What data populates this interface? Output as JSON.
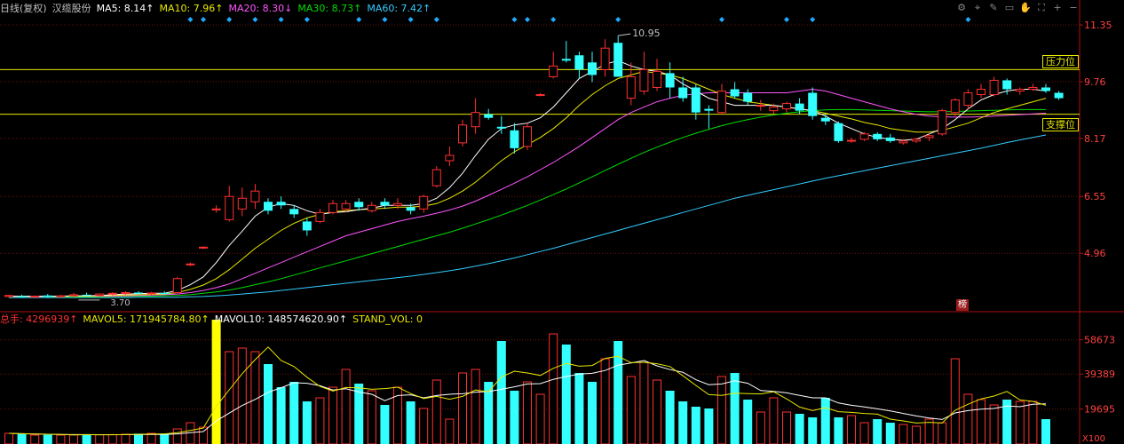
{
  "header": {
    "period": "日线(复权)",
    "stock_name": "汉缆股份",
    "ma": [
      {
        "label": "MA5: 8.14",
        "arrow": "↑",
        "color": "#ffffff"
      },
      {
        "label": "MA10: 7.96",
        "arrow": "↑",
        "color": "#e8e800"
      },
      {
        "label": "MA20: 8.30",
        "arrow": "↓",
        "color": "#ff55ff"
      },
      {
        "label": "MA30: 8.73",
        "arrow": "↑",
        "color": "#00dd00"
      },
      {
        "label": "MA60: 7.42",
        "arrow": "↑",
        "color": "#33ccff"
      }
    ],
    "vol": [
      {
        "label": "总手: 4296939",
        "arrow": "↑",
        "color": "#ff3030"
      },
      {
        "label": "MAVOL5: 171945784.80",
        "arrow": "↑",
        "color": "#e8e800"
      },
      {
        "label": "MAVOL10: 148574620.90",
        "arrow": "↑",
        "color": "#ffffff"
      },
      {
        "label": "STAND_VOL: 0",
        "arrow": "",
        "color": "#e8e800"
      }
    ]
  },
  "toolbar": {
    "icons": [
      "gear-icon",
      "magnet-icon",
      "pen-icon",
      "toolbox-icon",
      "hand-icon",
      "fullscreen-icon",
      "zoom-in-icon",
      "zoom-out-icon"
    ],
    "glyphs": [
      "⚙",
      "⌖",
      "✎",
      "▭",
      "✋",
      "⛶",
      "+",
      "−"
    ]
  },
  "annotations": {
    "resistance": "压力位",
    "support": "支撑位",
    "high": "10.95",
    "low": "3.70",
    "rank_badge": "榜"
  },
  "colors": {
    "up": "#ff3030",
    "down": "#33ffff",
    "grid": "#6a1010",
    "axis": "#b01010",
    "level": "#e8e800",
    "volume_surge": "#ffff00"
  },
  "chart_data": [
    {
      "type": "candlestick",
      "ylim": [
        3.4,
        11.6
      ],
      "y_ticks": [
        11.35,
        9.76,
        8.17,
        6.55,
        4.96
      ],
      "horizontal_levels": [
        {
          "name": "压力位",
          "value": 10.1
        },
        {
          "name": "支撑位",
          "value": 8.85
        }
      ],
      "grid": true,
      "markers_count": 18,
      "candles": [
        {
          "o": 3.75,
          "h": 3.8,
          "l": 3.72,
          "c": 3.78
        },
        {
          "o": 3.76,
          "h": 3.8,
          "l": 3.72,
          "c": 3.74
        },
        {
          "o": 3.74,
          "h": 3.78,
          "l": 3.7,
          "c": 3.76
        },
        {
          "o": 3.78,
          "h": 3.82,
          "l": 3.72,
          "c": 3.74
        },
        {
          "o": 3.74,
          "h": 3.8,
          "l": 3.72,
          "c": 3.77
        },
        {
          "o": 3.77,
          "h": 3.85,
          "l": 3.74,
          "c": 3.8
        },
        {
          "o": 3.8,
          "h": 3.86,
          "l": 3.76,
          "c": 3.78
        },
        {
          "o": 3.78,
          "h": 3.84,
          "l": 3.75,
          "c": 3.82
        },
        {
          "o": 3.82,
          "h": 3.87,
          "l": 3.78,
          "c": 3.84
        },
        {
          "o": 3.84,
          "h": 3.9,
          "l": 3.8,
          "c": 3.86
        },
        {
          "o": 3.86,
          "h": 3.9,
          "l": 3.8,
          "c": 3.83
        },
        {
          "o": 3.83,
          "h": 3.88,
          "l": 3.78,
          "c": 3.85
        },
        {
          "o": 3.85,
          "h": 3.9,
          "l": 3.82,
          "c": 3.82
        },
        {
          "o": 3.86,
          "h": 4.3,
          "l": 3.84,
          "c": 4.25
        },
        {
          "o": 4.66,
          "h": 4.7,
          "l": 4.6,
          "c": 4.66
        },
        {
          "o": 5.13,
          "h": 5.16,
          "l": 5.08,
          "c": 5.13
        },
        {
          "o": 6.2,
          "h": 6.3,
          "l": 6.1,
          "c": 6.2
        },
        {
          "o": 5.9,
          "h": 6.85,
          "l": 5.85,
          "c": 6.55
        },
        {
          "o": 6.2,
          "h": 6.8,
          "l": 6.0,
          "c": 6.5
        },
        {
          "o": 6.4,
          "h": 6.9,
          "l": 6.2,
          "c": 6.7
        },
        {
          "o": 6.4,
          "h": 6.5,
          "l": 6.05,
          "c": 6.15
        },
        {
          "o": 6.4,
          "h": 6.55,
          "l": 6.2,
          "c": 6.3
        },
        {
          "o": 6.2,
          "h": 6.3,
          "l": 5.95,
          "c": 6.05
        },
        {
          "o": 5.85,
          "h": 5.95,
          "l": 5.45,
          "c": 5.6
        },
        {
          "o": 5.85,
          "h": 6.2,
          "l": 5.8,
          "c": 6.1
        },
        {
          "o": 6.1,
          "h": 6.45,
          "l": 6.05,
          "c": 6.35
        },
        {
          "o": 6.2,
          "h": 6.45,
          "l": 6.1,
          "c": 6.35
        },
        {
          "o": 6.4,
          "h": 6.5,
          "l": 6.15,
          "c": 6.25
        },
        {
          "o": 6.15,
          "h": 6.4,
          "l": 6.1,
          "c": 6.3
        },
        {
          "o": 6.4,
          "h": 6.5,
          "l": 6.2,
          "c": 6.3
        },
        {
          "o": 6.3,
          "h": 6.5,
          "l": 6.2,
          "c": 6.35
        },
        {
          "o": 6.25,
          "h": 6.35,
          "l": 6.05,
          "c": 6.15
        },
        {
          "o": 6.2,
          "h": 6.6,
          "l": 6.1,
          "c": 6.55
        },
        {
          "o": 6.85,
          "h": 7.4,
          "l": 6.8,
          "c": 7.3
        },
        {
          "o": 7.55,
          "h": 7.95,
          "l": 7.4,
          "c": 7.7
        },
        {
          "o": 8.05,
          "h": 8.7,
          "l": 7.95,
          "c": 8.55
        },
        {
          "o": 8.5,
          "h": 9.3,
          "l": 8.3,
          "c": 8.9
        },
        {
          "o": 8.85,
          "h": 9.0,
          "l": 8.7,
          "c": 8.75
        },
        {
          "o": 8.5,
          "h": 8.8,
          "l": 8.3,
          "c": 8.45
        },
        {
          "o": 8.4,
          "h": 8.6,
          "l": 7.75,
          "c": 7.9
        },
        {
          "o": 7.95,
          "h": 8.6,
          "l": 7.85,
          "c": 8.5
        },
        {
          "o": 9.4,
          "h": 9.45,
          "l": 9.35,
          "c": 9.4
        },
        {
          "o": 9.9,
          "h": 10.6,
          "l": 9.85,
          "c": 10.2
        },
        {
          "o": 10.4,
          "h": 10.9,
          "l": 10.3,
          "c": 10.35
        },
        {
          "o": 10.5,
          "h": 10.6,
          "l": 9.85,
          "c": 10.1
        },
        {
          "o": 10.3,
          "h": 10.6,
          "l": 9.75,
          "c": 9.95
        },
        {
          "o": 10.1,
          "h": 10.95,
          "l": 9.9,
          "c": 10.7
        },
        {
          "o": 10.85,
          "h": 11.05,
          "l": 10.0,
          "c": 9.9
        },
        {
          "o": 9.3,
          "h": 10.3,
          "l": 9.1,
          "c": 9.9
        },
        {
          "o": 9.5,
          "h": 10.6,
          "l": 9.4,
          "c": 10.1
        },
        {
          "o": 9.6,
          "h": 10.4,
          "l": 9.5,
          "c": 10.05
        },
        {
          "o": 10.0,
          "h": 10.3,
          "l": 9.3,
          "c": 9.6
        },
        {
          "o": 9.6,
          "h": 9.9,
          "l": 9.2,
          "c": 9.3
        },
        {
          "o": 9.6,
          "h": 9.7,
          "l": 8.7,
          "c": 8.9
        },
        {
          "o": 9.0,
          "h": 9.1,
          "l": 8.45,
          "c": 8.95
        },
        {
          "o": 8.9,
          "h": 9.7,
          "l": 8.85,
          "c": 9.5
        },
        {
          "o": 9.55,
          "h": 9.75,
          "l": 9.3,
          "c": 9.35
        },
        {
          "o": 9.45,
          "h": 9.55,
          "l": 9.1,
          "c": 9.2
        },
        {
          "o": 9.1,
          "h": 9.25,
          "l": 8.95,
          "c": 9.1
        },
        {
          "o": 8.95,
          "h": 9.15,
          "l": 8.85,
          "c": 9.05
        },
        {
          "o": 9.0,
          "h": 9.2,
          "l": 8.9,
          "c": 9.15
        },
        {
          "o": 9.15,
          "h": 9.3,
          "l": 8.85,
          "c": 8.95
        },
        {
          "o": 9.45,
          "h": 9.6,
          "l": 8.7,
          "c": 8.8
        },
        {
          "o": 8.75,
          "h": 8.85,
          "l": 8.55,
          "c": 8.65
        },
        {
          "o": 8.6,
          "h": 8.65,
          "l": 8.05,
          "c": 8.1
        },
        {
          "o": 8.1,
          "h": 8.2,
          "l": 8.05,
          "c": 8.12
        },
        {
          "o": 8.15,
          "h": 8.35,
          "l": 8.1,
          "c": 8.3
        },
        {
          "o": 8.3,
          "h": 8.35,
          "l": 8.1,
          "c": 8.15
        },
        {
          "o": 8.2,
          "h": 8.3,
          "l": 8.05,
          "c": 8.1
        },
        {
          "o": 8.05,
          "h": 8.15,
          "l": 8.0,
          "c": 8.1
        },
        {
          "o": 8.1,
          "h": 8.2,
          "l": 8.05,
          "c": 8.15
        },
        {
          "o": 8.2,
          "h": 8.3,
          "l": 8.1,
          "c": 8.25
        },
        {
          "o": 8.3,
          "h": 9.0,
          "l": 8.25,
          "c": 8.95
        },
        {
          "o": 8.9,
          "h": 9.3,
          "l": 8.8,
          "c": 9.25
        },
        {
          "o": 9.1,
          "h": 9.55,
          "l": 9.0,
          "c": 9.45
        },
        {
          "o": 9.4,
          "h": 9.7,
          "l": 9.3,
          "c": 9.55
        },
        {
          "o": 9.4,
          "h": 9.9,
          "l": 9.35,
          "c": 9.8
        },
        {
          "o": 9.8,
          "h": 9.85,
          "l": 9.4,
          "c": 9.55
        },
        {
          "o": 9.5,
          "h": 9.6,
          "l": 9.4,
          "c": 9.55
        },
        {
          "o": 9.55,
          "h": 9.7,
          "l": 9.5,
          "c": 9.6
        },
        {
          "o": 9.6,
          "h": 9.7,
          "l": 9.45,
          "c": 9.5
        },
        {
          "o": 9.45,
          "h": 9.5,
          "l": 9.25,
          "c": 9.3
        }
      ],
      "ma5": [
        3.76,
        3.76,
        3.76,
        3.76,
        3.76,
        3.77,
        3.77,
        3.78,
        3.8,
        3.82,
        3.83,
        3.84,
        3.84,
        3.92,
        4.08,
        4.3,
        4.7,
        5.18,
        5.58,
        6.0,
        6.25,
        6.35,
        6.3,
        6.15,
        6.05,
        6.1,
        6.12,
        6.18,
        6.22,
        6.3,
        6.3,
        6.3,
        6.35,
        6.5,
        6.8,
        7.2,
        7.7,
        8.15,
        8.45,
        8.55,
        8.6,
        8.75,
        9.05,
        9.45,
        9.85,
        10.05,
        10.25,
        10.35,
        10.2,
        10.1,
        10.05,
        9.95,
        9.7,
        9.5,
        9.3,
        9.2,
        9.1,
        9.1,
        9.1,
        9.1,
        9.05,
        9.0,
        8.95,
        8.8,
        8.6,
        8.45,
        8.3,
        8.2,
        8.15,
        8.12,
        8.15,
        8.3,
        8.45,
        8.7,
        9.0,
        9.25,
        9.4,
        9.5,
        9.55,
        9.55,
        9.5
      ],
      "ma10": [
        3.76,
        3.76,
        3.76,
        3.76,
        3.76,
        3.76,
        3.76,
        3.77,
        3.78,
        3.79,
        3.8,
        3.81,
        3.82,
        3.86,
        3.95,
        4.07,
        4.25,
        4.5,
        4.8,
        5.1,
        5.35,
        5.6,
        5.8,
        5.95,
        6.05,
        6.12,
        6.15,
        6.18,
        6.2,
        6.22,
        6.25,
        6.25,
        6.28,
        6.35,
        6.5,
        6.7,
        6.95,
        7.25,
        7.55,
        7.8,
        8.0,
        8.2,
        8.45,
        8.75,
        9.1,
        9.4,
        9.65,
        9.85,
        9.95,
        10.05,
        10.0,
        9.95,
        9.85,
        9.7,
        9.55,
        9.4,
        9.3,
        9.2,
        9.15,
        9.1,
        9.05,
        9.0,
        8.95,
        8.88,
        8.8,
        8.72,
        8.62,
        8.55,
        8.45,
        8.4,
        8.35,
        8.35,
        8.4,
        8.5,
        8.6,
        8.75,
        8.9,
        9.0,
        9.1,
        9.2,
        9.3
      ],
      "ma20": [
        3.75,
        3.75,
        3.75,
        3.75,
        3.76,
        3.76,
        3.76,
        3.76,
        3.76,
        3.77,
        3.78,
        3.79,
        3.8,
        3.82,
        3.86,
        3.92,
        4.0,
        4.1,
        4.25,
        4.4,
        4.55,
        4.7,
        4.85,
        5.0,
        5.15,
        5.3,
        5.45,
        5.55,
        5.65,
        5.75,
        5.85,
        5.93,
        6.0,
        6.08,
        6.17,
        6.28,
        6.42,
        6.58,
        6.75,
        6.92,
        7.1,
        7.3,
        7.5,
        7.72,
        7.95,
        8.2,
        8.45,
        8.7,
        8.9,
        9.05,
        9.2,
        9.3,
        9.38,
        9.42,
        9.45,
        9.45,
        9.45,
        9.45,
        9.45,
        9.45,
        9.45,
        9.5,
        9.55,
        9.5,
        9.4,
        9.3,
        9.2,
        9.1,
        9.0,
        8.92,
        8.85,
        8.8,
        8.78,
        8.77,
        8.77,
        8.78,
        8.8,
        8.82,
        8.84,
        8.86,
        8.88
      ],
      "ma30": [
        3.74,
        3.74,
        3.74,
        3.74,
        3.74,
        3.74,
        3.74,
        3.74,
        3.75,
        3.75,
        3.76,
        3.76,
        3.77,
        3.78,
        3.8,
        3.84,
        3.88,
        3.93,
        4.0,
        4.08,
        4.16,
        4.25,
        4.35,
        4.45,
        4.55,
        4.65,
        4.75,
        4.85,
        4.95,
        5.05,
        5.15,
        5.25,
        5.35,
        5.45,
        5.55,
        5.66,
        5.78,
        5.9,
        6.03,
        6.16,
        6.3,
        6.45,
        6.6,
        6.76,
        6.93,
        7.1,
        7.28,
        7.45,
        7.62,
        7.78,
        7.93,
        8.07,
        8.2,
        8.32,
        8.43,
        8.53,
        8.62,
        8.7,
        8.77,
        8.83,
        8.88,
        8.92,
        8.95,
        8.97,
        8.98,
        8.98,
        8.97,
        8.96,
        8.95,
        8.94,
        8.93,
        8.92,
        8.92,
        8.93,
        8.94,
        8.95,
        8.96,
        8.97,
        8.98,
        8.98,
        8.98
      ],
      "ma60": [
        3.72,
        3.72,
        3.72,
        3.72,
        3.72,
        3.72,
        3.72,
        3.72,
        3.72,
        3.72,
        3.73,
        3.73,
        3.73,
        3.73,
        3.74,
        3.75,
        3.77,
        3.79,
        3.82,
        3.85,
        3.88,
        3.92,
        3.96,
        4.0,
        4.04,
        4.08,
        4.12,
        4.16,
        4.2,
        4.24,
        4.28,
        4.32,
        4.37,
        4.42,
        4.47,
        4.53,
        4.6,
        4.67,
        4.75,
        4.83,
        4.92,
        5.01,
        5.1,
        5.2,
        5.3,
        5.4,
        5.5,
        5.6,
        5.7,
        5.8,
        5.9,
        6.0,
        6.1,
        6.2,
        6.3,
        6.4,
        6.5,
        6.58,
        6.66,
        6.74,
        6.82,
        6.9,
        6.98,
        7.06,
        7.13,
        7.2,
        7.27,
        7.34,
        7.41,
        7.48,
        7.55,
        7.62,
        7.69,
        7.76,
        7.83,
        7.9,
        7.98,
        8.06,
        8.13,
        8.2,
        8.27
      ]
    },
    {
      "type": "bar",
      "y_ticks": [
        58673,
        39389,
        19695
      ],
      "unit_label": "X100",
      "volumes": [
        6000,
        5500,
        5000,
        5200,
        5000,
        5100,
        5400,
        5200,
        5300,
        5500,
        5800,
        6000,
        5900,
        8500,
        12000,
        9500,
        70000,
        52000,
        54000,
        52000,
        45000,
        32000,
        35000,
        24000,
        26000,
        32000,
        42000,
        34000,
        30000,
        22000,
        32000,
        24000,
        20000,
        36000,
        14000,
        40000,
        42000,
        35000,
        58000,
        30000,
        35000,
        28000,
        62000,
        56000,
        40000,
        35000,
        48000,
        58000,
        38000,
        46000,
        36000,
        30000,
        24000,
        21000,
        20000,
        38000,
        40000,
        25000,
        18000,
        26000,
        18000,
        17000,
        15000,
        26000,
        15000,
        16000,
        12000,
        14000,
        12000,
        11000,
        10000,
        14000,
        12000,
        48000,
        28000,
        25000,
        22000,
        25000,
        24000,
        24000,
        14000
      ],
      "mavol5": [
        6000,
        5800,
        5600,
        5500,
        5350,
        5160,
        5240,
        5180,
        5200,
        5300,
        5440,
        5600,
        5700,
        6340,
        7640,
        8980,
        21180,
        30500,
        39600,
        47500,
        54600,
        47000,
        43600,
        37600,
        32400,
        29800,
        31800,
        31600,
        30800,
        31200,
        32000,
        28400,
        25600,
        26800,
        25200,
        26800,
        30400,
        29400,
        37800,
        41000,
        40000,
        38600,
        42600,
        45400,
        43800,
        44200,
        48200,
        49400,
        45800,
        46000,
        45200,
        43600,
        38400,
        33000,
        27800,
        27400,
        28600,
        28400,
        28200,
        29400,
        25400,
        20800,
        18800,
        20400,
        18200,
        17800,
        17200,
        16800,
        14000,
        13000,
        11800,
        12200,
        11800,
        19000,
        22400,
        25400,
        27000,
        29600,
        24800,
        24000,
        21800
      ],
      "mavol10": [
        6000,
        5800,
        5600,
        5500,
        5350,
        5300,
        5300,
        5250,
        5250,
        5250,
        5300,
        5350,
        5400,
        5700,
        6400,
        7000,
        13000,
        17400,
        21700,
        25100,
        29100,
        31700,
        34500,
        34200,
        32800,
        30400,
        31100,
        29300,
        28000,
        24400,
        27300,
        27700,
        26000,
        27300,
        28000,
        28300,
        29200,
        29500,
        30800,
        32200,
        33800,
        34000,
        36400,
        38000,
        39400,
        39800,
        41400,
        44400,
        45600,
        47000,
        44000,
        41900,
        40400,
        36200,
        33400,
        33800,
        35600,
        34200,
        30100,
        29600,
        28800,
        27400,
        26000,
        26000,
        23100,
        21800,
        20900,
        19800,
        18600,
        17200,
        15800,
        14600,
        13800,
        17500,
        18800,
        19600,
        20000,
        21400,
        21000,
        22400,
        22600
      ],
      "colors_by_candle": true
    }
  ]
}
